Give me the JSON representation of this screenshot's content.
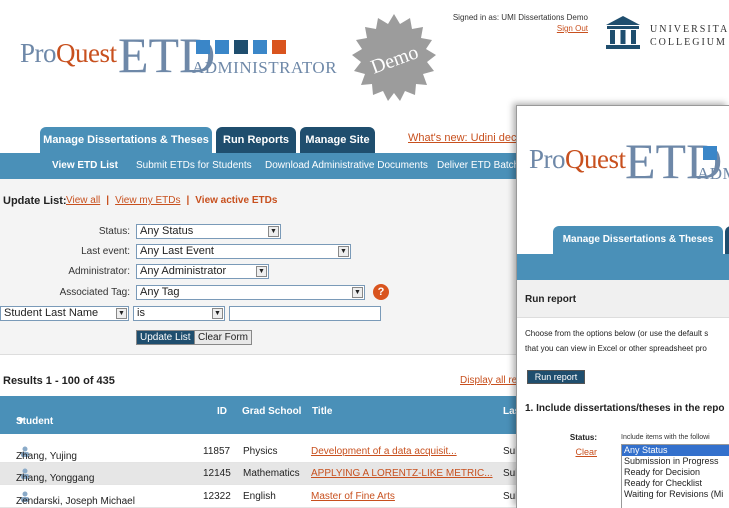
{
  "header": {
    "logo_pro": "Pro",
    "logo_quest": "Quest",
    "logo_etd": "ETD",
    "logo_admin": "ADMINISTRATOR",
    "demo_badge": "Demo",
    "signed_in": "Signed in as: UMI Dissertations Demo",
    "sign_out": "Sign Out",
    "university_line1": "UNIVERSITAS",
    "university_line2": "COLLEGIUM",
    "square_colors": [
      "#3a86c8",
      "#3a86c8",
      "#1f4e6e",
      "#3a86c8",
      "#d9541e"
    ]
  },
  "tabs": {
    "manage": "Manage Dissertations & Theses",
    "reports": "Run Reports",
    "site": "Manage Site",
    "whats_new": "What's new: Udini dec"
  },
  "subnav": {
    "view": "View ETD List",
    "submit": "Submit ETDs for Students",
    "download": "Download Administrative Documents",
    "deliver": "Deliver ETD Batch"
  },
  "filter": {
    "update_list": "Update List:",
    "view_all": "View all",
    "view_my": "View my ETDs",
    "view_active": "View active ETDs",
    "status_label": "Status:",
    "status_value": "Any Status",
    "event_label": "Last event:",
    "event_value": "Any Last Event",
    "admin_label": "Administrator:",
    "admin_value": "Any Administrator",
    "tag_label": "Associated Tag:",
    "tag_value": "Any Tag",
    "field_value": "Student Last Name",
    "op_value": "is",
    "text_value": "",
    "update_btn": "Update List",
    "clear_btn": "Clear Form",
    "help": "?"
  },
  "results": {
    "summary": "Results 1 - 100 of 435",
    "display_all": "Display all res",
    "columns": [
      "Student",
      "ID",
      "Grad School",
      "Title",
      "Las"
    ],
    "rows": [
      {
        "student": "Zhang, Yujing",
        "id": "11857",
        "school": "Physics",
        "title": "Development of a data acquisit...",
        "last": "Sub"
      },
      {
        "student": "Zhang, Yonggang",
        "id": "12145",
        "school": "Mathematics",
        "title": "APPLYING A LORENTZ-LIKE METRIC...",
        "last": "Sub"
      },
      {
        "student": "Zendarski, Joseph Michael",
        "id": "12322",
        "school": "English",
        "title": "Master of Fine Arts",
        "last": "Sub"
      }
    ]
  },
  "front": {
    "tab": "Manage Dissertations & Theses",
    "run_report_header": "Run report",
    "intro_line1": "Choose from the options below (or use the default s",
    "intro_line2": "that you can view in Excel or other spreadsheet pro",
    "run_btn": "Run report",
    "section1": "1. Include dissertations/theses in the repo",
    "status_label": "Status:",
    "clear": "Clear",
    "include_text": "Include items with the followi",
    "status_options": [
      "Any Status",
      "Submission in Progress",
      "Ready for Decision",
      "Ready for Checklist",
      "Waiting for Revisions (Mi"
    ]
  }
}
